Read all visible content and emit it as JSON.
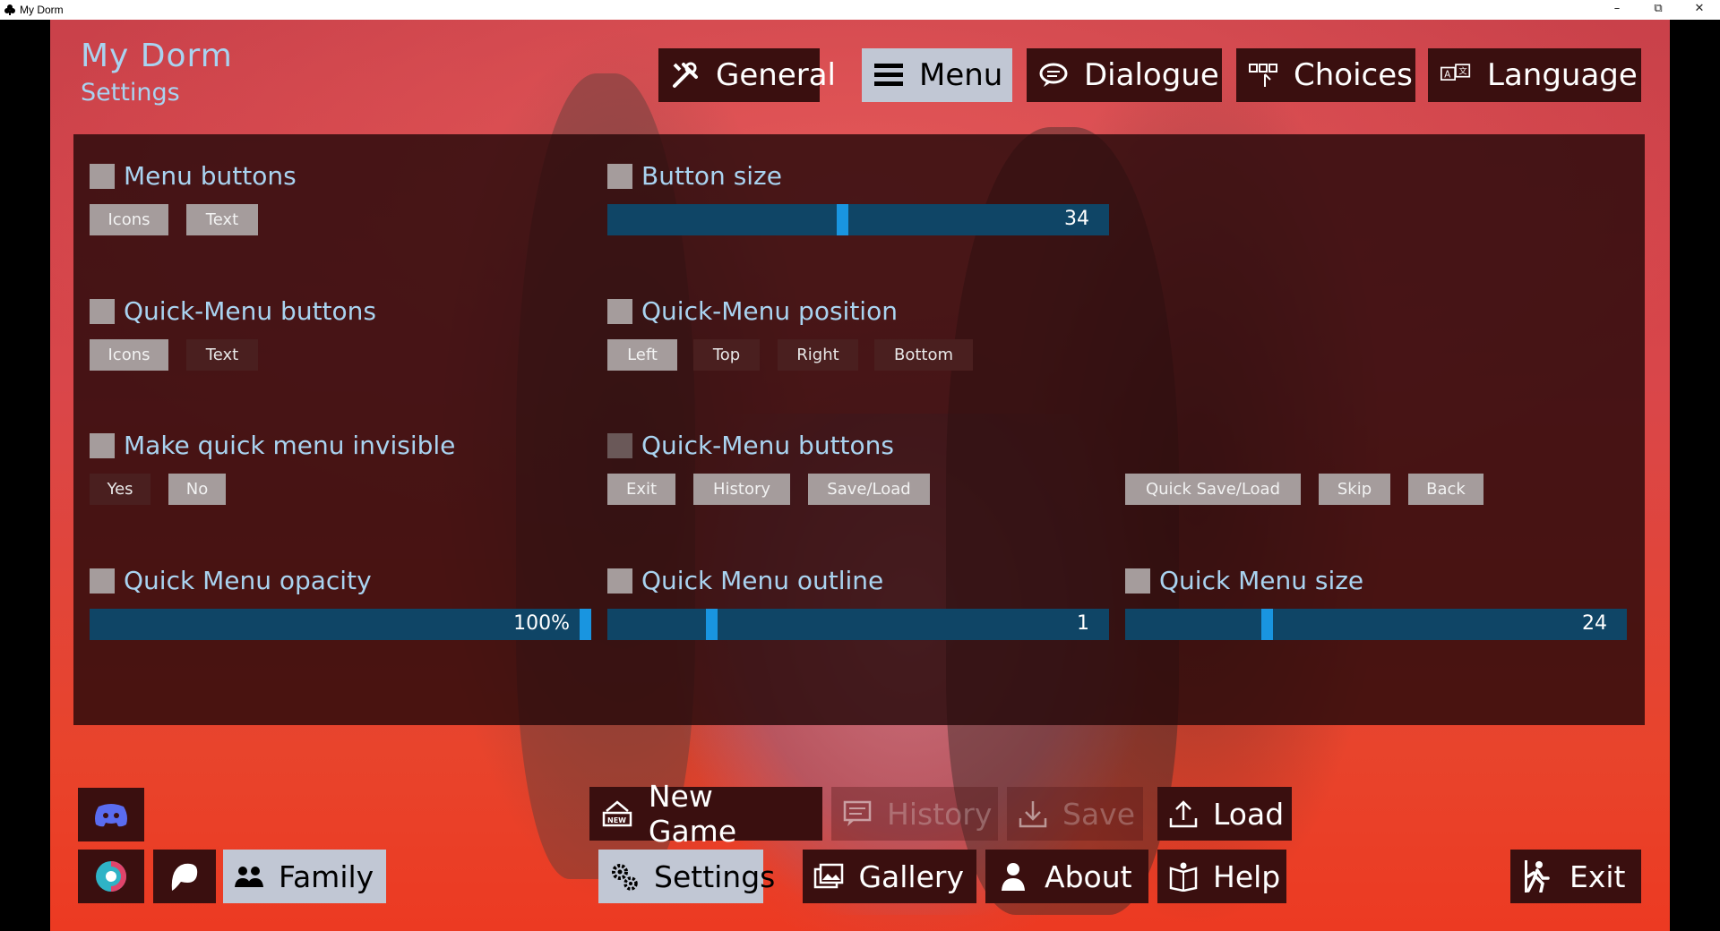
{
  "window": {
    "title": "My Dorm",
    "app_icon": "club-icon"
  },
  "game": {
    "title": "My Dorm",
    "subtitle": "Settings"
  },
  "tabs": [
    {
      "label": "General",
      "icon": "tools-icon",
      "active": false
    },
    {
      "label": "Menu",
      "icon": "hamburger-icon",
      "active": true
    },
    {
      "label": "Dialogue",
      "icon": "chat-bubble-icon",
      "active": false
    },
    {
      "label": "Choices",
      "icon": "choices-icon",
      "active": false
    },
    {
      "label": "Language",
      "icon": "translate-icon",
      "active": false
    }
  ],
  "settings": {
    "menu_buttons": {
      "label": "Menu buttons",
      "options": [
        "Icons",
        "Text"
      ],
      "selected": "Icons"
    },
    "button_size": {
      "label": "Button size",
      "value": "34",
      "fraction": 0.47
    },
    "qm_buttons_style": {
      "label": "Quick-Menu buttons",
      "options": [
        "Icons",
        "Text"
      ],
      "selected": "Icons"
    },
    "qm_position": {
      "label": "Quick-Menu position",
      "options": [
        "Left",
        "Top",
        "Right",
        "Bottom"
      ]
    },
    "qm_invisible": {
      "label": "Make quick menu invisible",
      "options": [
        "Yes",
        "No"
      ],
      "selected": "No"
    },
    "qm_buttons": {
      "label": "Quick-Menu buttons",
      "options": [
        "Exit",
        "History",
        "Save/Load",
        "Quick Save/Load",
        "Skip",
        "Back"
      ]
    },
    "qm_opacity": {
      "label": "Quick Menu opacity",
      "value": "100%",
      "fraction": 1.0
    },
    "qm_outline": {
      "label": "Quick Menu outline",
      "value": "1",
      "fraction": 0.2
    },
    "qm_size": {
      "label": "Quick Menu size",
      "value": "24",
      "fraction": 0.28
    }
  },
  "bottom_menu": {
    "new_game": "New Game",
    "history": "History",
    "save": "Save",
    "load": "Load",
    "settings": "Settings",
    "gallery": "Gallery",
    "about": "About",
    "help": "Help",
    "family": "Family",
    "exit": "Exit"
  },
  "colors": {
    "accent_text": "#a9d3f0",
    "button_bg": "#3a0f0f",
    "active_bg": "#c1c7d4",
    "slider_bg": "#0f4566",
    "slider_thumb": "#1995e0"
  }
}
